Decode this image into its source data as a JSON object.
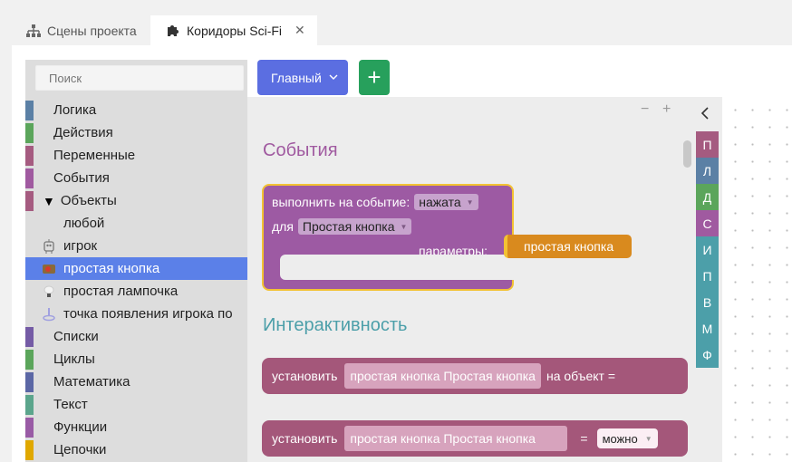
{
  "tabs": [
    {
      "label": "Сцены проекта",
      "icon": "sitemap-icon",
      "active": false
    },
    {
      "label": "Коридоры Sci-Fi",
      "icon": "puzzle-icon",
      "active": true
    }
  ],
  "toolbox": {
    "search_placeholder": "Поиск",
    "categories": [
      {
        "label": "Логика",
        "color": "#5b80a5"
      },
      {
        "label": "Действия",
        "color": "#5ba55b"
      },
      {
        "label": "Переменные",
        "color": "#a55b80"
      },
      {
        "label": "События",
        "color": "#a05aa0"
      },
      {
        "label": "Объекты",
        "color": "#a55b80"
      },
      {
        "label": "любой"
      },
      {
        "label": "игрок"
      },
      {
        "label": "простая кнопка"
      },
      {
        "label": "простая лампочка"
      },
      {
        "label": "точка появления игрока по"
      },
      {
        "label": "Списки",
        "color": "#745ba5"
      },
      {
        "label": "Циклы",
        "color": "#5ba55b"
      },
      {
        "label": "Математика",
        "color": "#5b67a5"
      },
      {
        "label": "Текст",
        "color": "#5ba58c"
      },
      {
        "label": "Функции",
        "color": "#995ba5"
      },
      {
        "label": "Цепочки",
        "color": "#e0a800"
      }
    ]
  },
  "header": {
    "main_button": "Главный",
    "add_button": "+"
  },
  "flyout": {
    "minus": "−",
    "plus": "+",
    "events_heading": "События",
    "event_block": {
      "line1_label": "выполнить на событие:",
      "line1_value": "нажата",
      "line2_label": "для",
      "line2_value": "Простая кнопка",
      "params_label": "параметры:",
      "param_value": "простая кнопка"
    },
    "interactivity_heading": "Интерактивность",
    "set_block_1": {
      "label": "установить",
      "slot": "простая кнопка Простая кнопка",
      "suffix": "на объект ="
    },
    "set_block_2": {
      "label": "установить",
      "slot": "простая кнопка Простая кнопка",
      "eq": "=",
      "value": "можно"
    }
  },
  "mini_categories": [
    {
      "letter": "П",
      "color": "#a55b80"
    },
    {
      "letter": "Л",
      "color": "#5b80a5"
    },
    {
      "letter": "Д",
      "color": "#5ba55b"
    },
    {
      "letter": "С",
      "color": "#a05aa0"
    },
    {
      "letter": "И",
      "color": "#4c9fa9"
    },
    {
      "letter": "П",
      "color": "#4c9fa9"
    },
    {
      "letter": "В",
      "color": "#4c9fa9"
    },
    {
      "letter": "М",
      "color": "#4c9fa9"
    },
    {
      "letter": "Ф",
      "color": "#4c9fa9"
    }
  ]
}
